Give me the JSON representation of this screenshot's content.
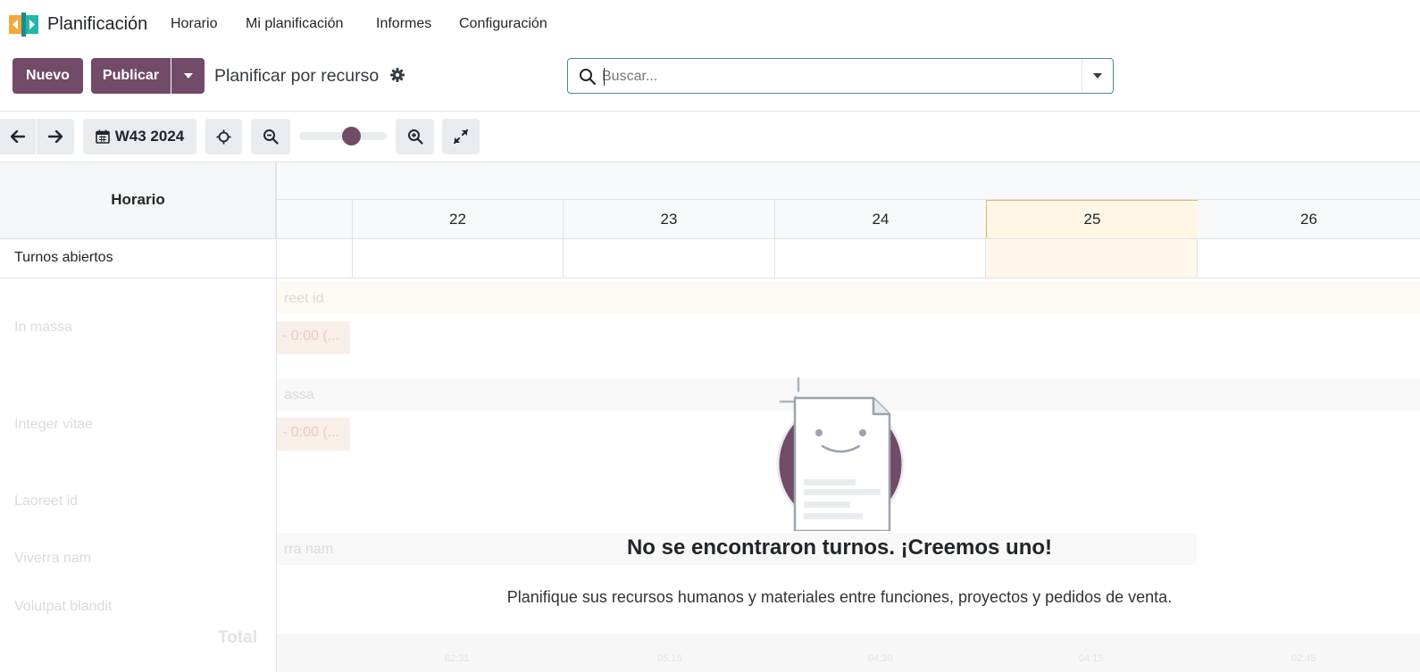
{
  "nav": {
    "app_title": "Planificación",
    "menu": [
      "Horario",
      "Mi planificación",
      "Informes",
      "Configuración"
    ]
  },
  "toolbar": {
    "new_label": "Nuevo",
    "publish_label": "Publicar",
    "view_title": "Planificar por recurso"
  },
  "search": {
    "placeholder": "Buscar..."
  },
  "gantt": {
    "period_label": "W43 2024",
    "zoom_level": 0.6,
    "left_header": "Horario",
    "days": [
      "22",
      "23",
      "24",
      "25",
      "26"
    ],
    "today": "25",
    "open_shifts_label": "Turnos abiertos",
    "sample_rows": [
      "In massa",
      "Integer vitae",
      "Laoreet id",
      "Viverra nam",
      "Volutpat blandit"
    ],
    "sample_bands": [
      "reet id",
      "assa",
      "rra nam"
    ],
    "sample_pills": [
      "- 0:00 (...",
      "- 0:00 (..."
    ],
    "total_label": "Total",
    "footer_values": [
      "02:31",
      "05:15",
      "04:30",
      "04:15",
      "02:45"
    ]
  },
  "empty_state": {
    "title": "No se encontraron turnos. ¡Creemos uno!",
    "text": "Planifique sus recursos humanos y materiales entre funciones, proyectos y pedidos de venta."
  },
  "colors": {
    "brand": "#714B67",
    "today_bg": "#fff6e6",
    "search_border": "#3f8e9c"
  }
}
